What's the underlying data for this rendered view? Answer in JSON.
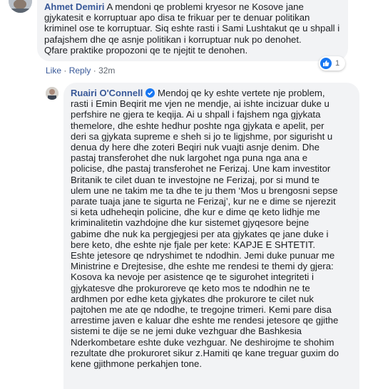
{
  "comment1": {
    "author": "Ahmet Demiri",
    "text": "A mendoni qe problemi kryesor ne Kosove jane\ngjykatesit e korruptuar apo disa te frikuar per te denuar politikan\nkriminel ose te korruptuar. Siq eshte rasti i Sami Lushtakut qe u shpall i\npafajshem dhe qe asnje politikan i korruptuar nuk po denohet.\nQfare praktike propozoni qe te njejtit te denohen.",
    "like_label": "Like",
    "reply_label": "Reply",
    "separator": "·",
    "time": "32m",
    "reaction_count": "1"
  },
  "comment2": {
    "author": "Ruairi O'Connell",
    "first_line": "Mendoj qe ky eshte vertete nje problem,",
    "text": "rasti i Emin Beqirit me vjen ne mendje, ai ishte incizuar duke u\nperfshire ne gjera te keqija. Ai u shpall i fajshem nga gjykata\nthemelore, dhe eshte hedhur poshte nga gjykata e apelit, per\nderi sa gjykata supreme e sheh si jo te ligjshme, por sigurisht u\ndenua dy here dhe zoteri Beqiri nuk vuajti asnje denim. Dhe\npastaj transferohet dhe nuk largohet nga puna nga ana e\npolicise, dhe pastaj transferohet ne Ferizaj. Une kam investitor\nBritanik te cilet duan te investojne ne Ferizaj, por si mund te\nulem une ne takim me ta dhe te ju them ‘Mos u brengosni sepse\nparate tuaja jane te sigurta ne Ferizaj’, kur ne e dime se njerezit\nsi keta udheheqin policine, dhe kur e dime qe keto lidhje me\nkriminalitetin vazhdojne dhe kur sistemet gjyqesore bejne\ngabime dhe nuk ka pergjegjesi per ata gjykates qe jane duke i\nbere keto, dhe eshte nje fjale per kete: KAPJE E SHTETIT.\nEshte jetesore qe ndryshimet te ndodhin. Jemi duke punuar me\nMinistrine e Drejtesise, dhe eshte me rendesi te themi dy gjera:\nKosova ka nevoje per asistence qe te sigurohet integriteti i\ngjykatesve dhe prokuroreve qe keto mos te ndodhin ne te\nardhmen por edhe keta gjykates dhe prokurore te cilet nuk\npajtohen me ate qe ndodhe, te tregojne trimeri. Kemi pare disa\narrestime javen e kaluar dhe eshte me rendesi jetesore qe gjithe\nsistemi te dije se ne jemi duke vezhguar dhe Bashkesia\nNderkombetare eshte duke vezhguar. Ne deshirojme te shohim\nrezultate dhe prokuroret sikur z.Hamiti qe kane treguar guxim do\nkene gjithmone perkahjen tone."
  },
  "icons": {
    "like": "thumbs-up-icon",
    "verified": "verified-badge-icon"
  },
  "colors": {
    "link": "#385898",
    "bubble": "#f2f3f5",
    "like_blue": "#1877f2"
  }
}
